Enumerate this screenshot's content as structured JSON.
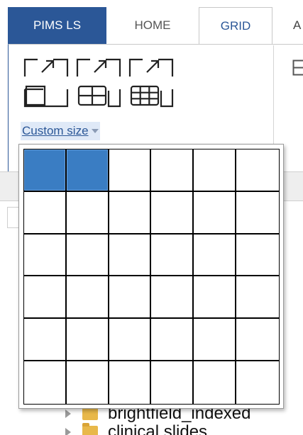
{
  "ribbon": {
    "tabs": [
      {
        "label": "PIMS LS",
        "active": false,
        "accent": true
      },
      {
        "label": "HOME",
        "active": false
      },
      {
        "label": "GRID",
        "active": true
      },
      {
        "label": "A",
        "active": false
      }
    ],
    "layout_buttons": [
      {
        "icon": "single-layout-icon"
      },
      {
        "icon": "grid-2x2-layout-icon"
      },
      {
        "icon": "grid-3x3-layout-icon"
      }
    ],
    "custom_size_label": "Custom size"
  },
  "grid_picker": {
    "rows": 6,
    "columns": 6,
    "selected_rows": 1,
    "selected_columns": 2
  },
  "tree": {
    "items": [
      {
        "label": "brightfield_indexed"
      },
      {
        "label": "clinical slides"
      }
    ]
  },
  "colors": {
    "accent": "#2b5797",
    "selection": "#3a7dc3"
  }
}
